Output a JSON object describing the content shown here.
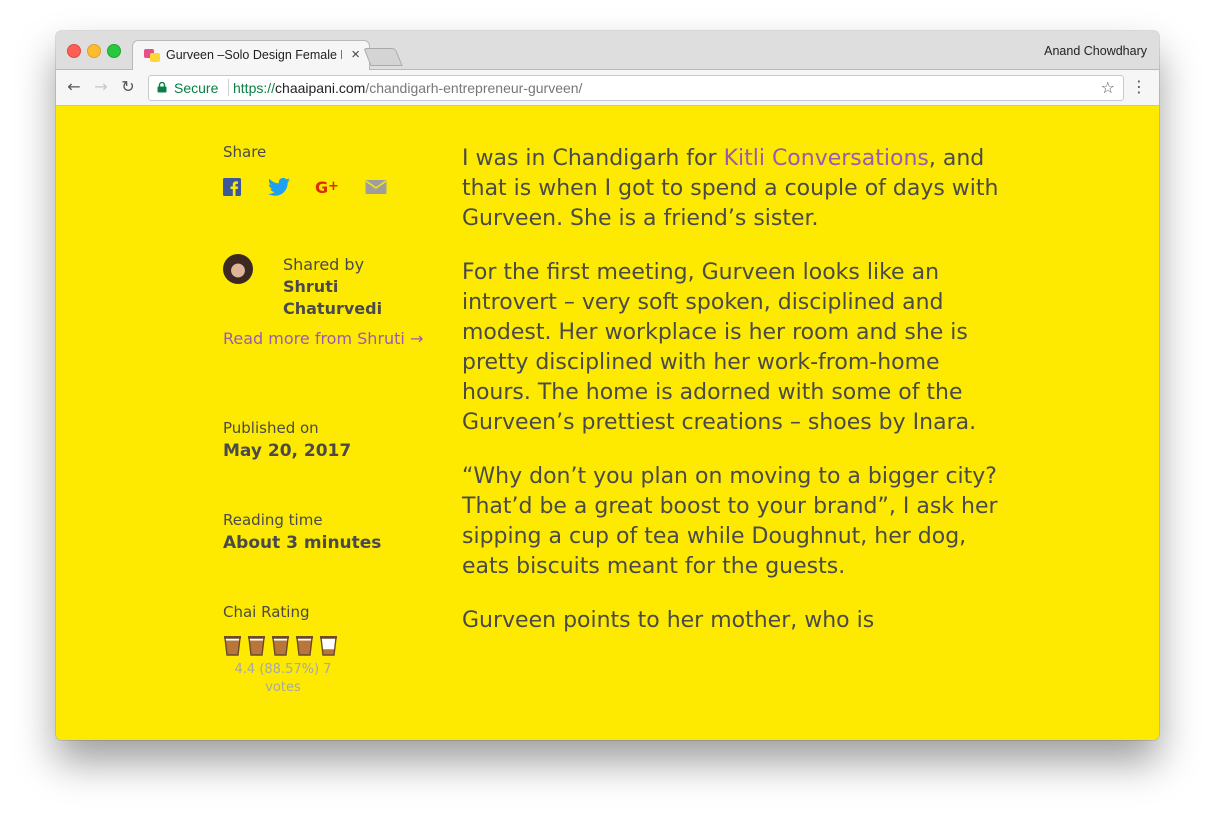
{
  "browser": {
    "tab_title": "Gurveen –Solo Design Female E",
    "profile_name": "Anand Chowdhary",
    "secure_label": "Secure",
    "url_scheme": "https://",
    "url_host": "chaaipani.com",
    "url_path": "/chandigarh-entrepreneur-gurveen/"
  },
  "sidebar": {
    "share_label": "Share",
    "social_icons": [
      "facebook-icon",
      "twitter-icon",
      "google-plus-icon",
      "email-icon"
    ],
    "shared_by_label": "Shared by",
    "author": "Shruti Chaturvedi",
    "read_more": "Read more from Shruti →",
    "published_label": "Published on",
    "published_date": "May 20, 2017",
    "reading_label": "Reading time",
    "reading_time": "About 3 minutes",
    "rating_label": "Chai Rating",
    "rating_value": 4.4,
    "rating_max": 5,
    "rating_text": "4.4 (88.57%) 7 votes"
  },
  "article": {
    "p1_before": "I was in Chandigarh for ",
    "p1_link": "Kitli Conversations",
    "p1_after": ", and that is when I got to spend a couple of days with Gurveen. She is a friend’s sister.",
    "p2": "For the first meeting, Gurveen looks like an introvert – very soft spoken, disciplined and modest. Her workplace is her room and she is pretty disciplined with her work-from-home hours. The home is adorned with some of the Gurveen’s prettiest creations – shoes by Inara.",
    "p3": "“Why don’t you plan on moving to a bigger city? That’d be a great boost to your brand”, I ask her sipping a cup of tea while Doughnut, her dog, eats biscuits meant for the guests.",
    "p4": "Gurveen points to her mother, who is"
  },
  "colors": {
    "page_bg": "#fdea00",
    "text": "#4a4a4a",
    "link": "#9b59b6",
    "facebook": "#3b5998",
    "twitter": "#1da1f2",
    "google_plus": "#dd2c00",
    "email": "#9e9e9e",
    "secure": "#0b8043"
  }
}
